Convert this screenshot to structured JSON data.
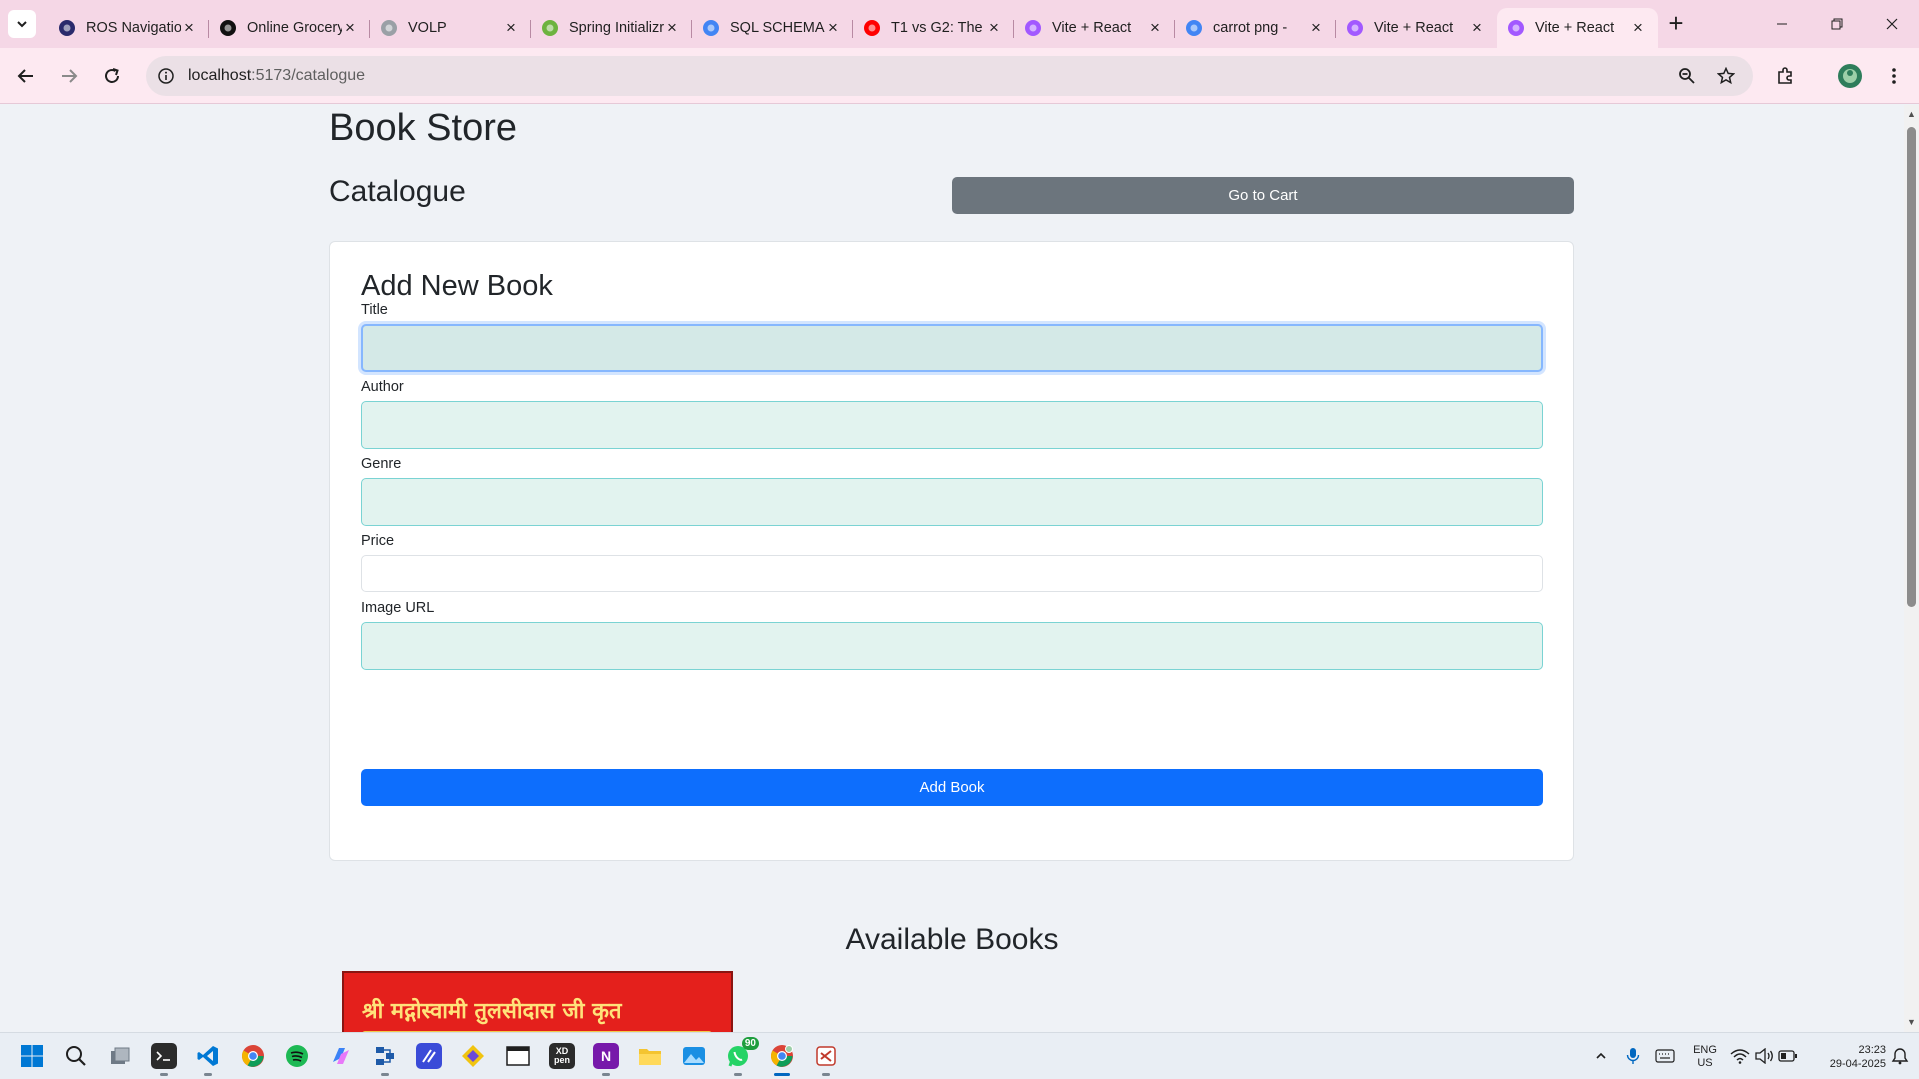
{
  "browser": {
    "tabs": [
      {
        "title": "ROS Navigation",
        "icon": "unstop-icon",
        "color": "#2a2a6c"
      },
      {
        "title": "Online Grocery",
        "icon": "openai-icon",
        "color": "#111111"
      },
      {
        "title": "VOLP",
        "icon": "globe-icon",
        "color": "#9aa0a6"
      },
      {
        "title": "Spring Initializr",
        "icon": "spring-icon",
        "color": "#6db33f"
      },
      {
        "title": "SQL SCHEMA",
        "icon": "google-icon",
        "color": "#4285f4"
      },
      {
        "title": "T1 vs G2: The",
        "icon": "youtube-icon",
        "color": "#ff0000"
      },
      {
        "title": "Vite + React",
        "icon": "vite-icon",
        "color": "#a259ff"
      },
      {
        "title": "carrot png -",
        "icon": "google-icon",
        "color": "#4285f4"
      },
      {
        "title": "Vite + React",
        "icon": "vite-icon",
        "color": "#a259ff"
      },
      {
        "title": "Vite + React",
        "icon": "vite-icon",
        "color": "#a259ff"
      }
    ],
    "active_tab": 9,
    "new_tab": "+",
    "url_host": "localhost",
    "url_path": ":5173/catalogue"
  },
  "page": {
    "store_title": "Book Store",
    "catalogue_title": "Catalogue",
    "cart_button": "Go to Cart",
    "form": {
      "heading": "Add New Book",
      "fields": [
        {
          "label": "Title",
          "value": ""
        },
        {
          "label": "Author",
          "value": ""
        },
        {
          "label": "Genre",
          "value": ""
        },
        {
          "label": "Price",
          "value": ""
        },
        {
          "label": "Image URL",
          "value": ""
        }
      ],
      "submit": "Add Book"
    },
    "available_heading": "Available Books",
    "book_cover_text": "श्री मद्गोस्वामी तुलसीदास जी कृत"
  },
  "colors": {
    "accent": "#0d6efd",
    "secondary": "#6c757d",
    "tabbar": "#f5d7e6",
    "page_bg": "#eff2f6"
  },
  "taskbar": {
    "apps": [
      "windows-start-icon",
      "search-icon",
      "task-view-icon",
      "terminal-icon",
      "vscode-icon",
      "chrome-icon",
      "spotify-icon",
      "copilot-icon",
      "network-app-icon",
      "notepad-icon",
      "git-icon",
      "window-app-icon",
      "xd-pen-icon",
      "onenote-icon",
      "file-explorer-icon",
      "photos-icon",
      "whatsapp-icon",
      "chrome-profile-icon",
      "snipping-tool-icon"
    ],
    "whatsapp_badge": "90",
    "lang_1": "ENG",
    "lang_2": "US",
    "time": "23:23",
    "date": "29-04-2025"
  }
}
